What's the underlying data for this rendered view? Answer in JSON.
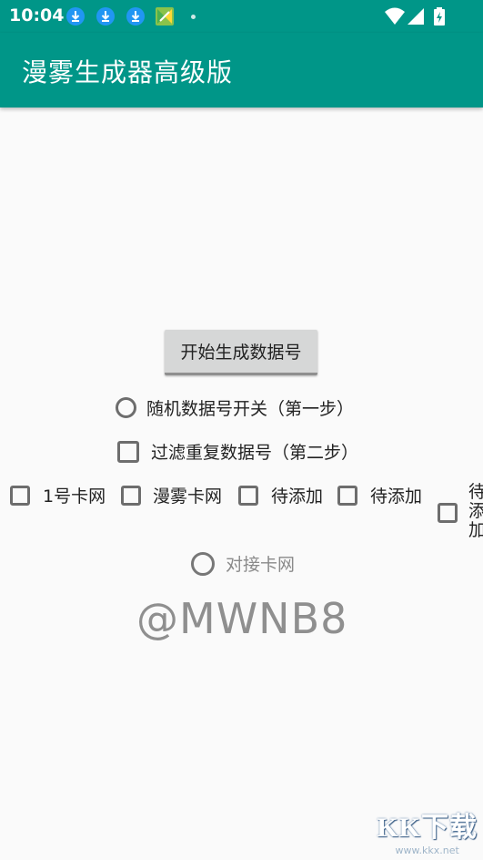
{
  "status_bar": {
    "time": "10:04",
    "icons": [
      "download-icon",
      "download-icon",
      "download-icon",
      "app-notification-icon",
      "dot-icon",
      "wifi-icon",
      "signal-icon",
      "battery-icon"
    ]
  },
  "app_bar": {
    "title": "漫雾生成器高级版"
  },
  "main": {
    "start_button": "开始生成数据号",
    "radio_random": "随机数据号开关（第一步）",
    "checkbox_filter": "过滤重复数据号（第二步）",
    "checkboxes": [
      "1号卡网",
      "漫雾卡网",
      "待添加",
      "待添加"
    ],
    "checkbox_overflow_chars": [
      "待",
      "添",
      "加"
    ],
    "radio_connect": "对接卡网",
    "watermark": "@MWNB8"
  },
  "site_watermark": {
    "logo": "KK下载",
    "url": "www.kkx.net"
  },
  "colors": {
    "primary": "#009688",
    "background": "#fafafa"
  }
}
